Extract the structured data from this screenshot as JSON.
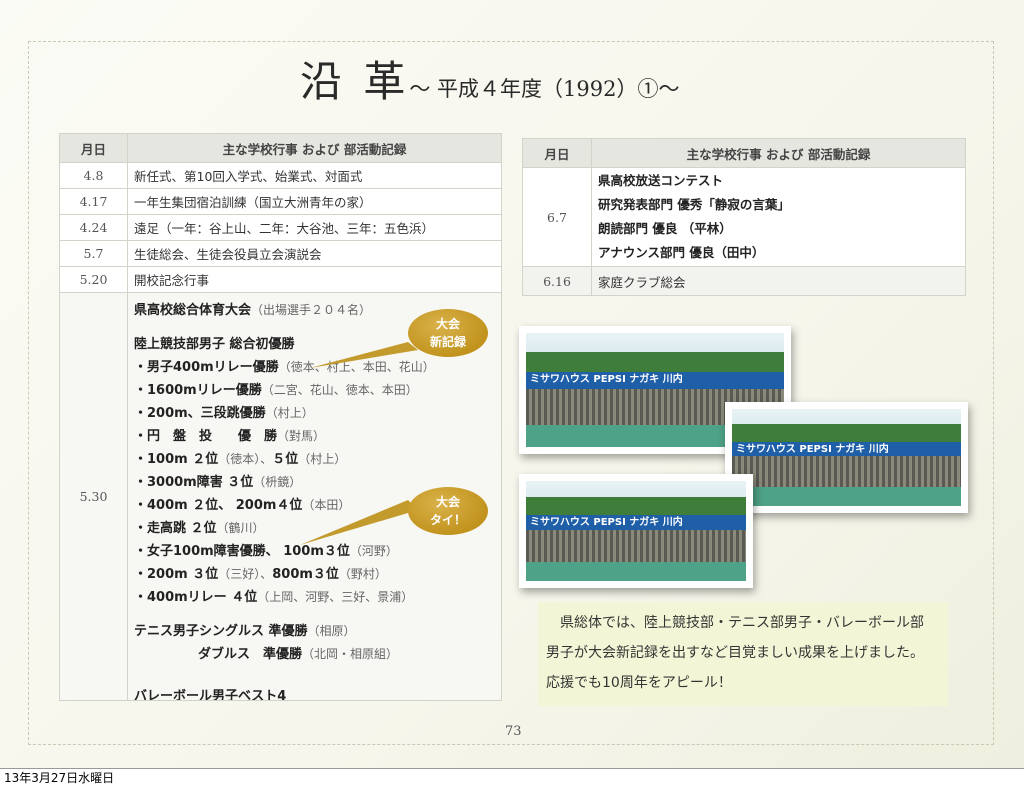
{
  "title": {
    "main": "沿 革",
    "sub": "〜 平成４年度（1992）①〜"
  },
  "left_table": {
    "headers": [
      "月日",
      "主な学校行事 および 部活動記録"
    ],
    "rows": [
      {
        "date": "4.8",
        "text": "新任式、第10回入学式、始業式、対面式"
      },
      {
        "date": "4.17",
        "text": "一年生集団宿泊訓練（国立大洲青年の家）"
      },
      {
        "date": "4.24",
        "text": "遠足（一年：谷上山、二年：大谷池、三年：五色浜）"
      },
      {
        "date": "5.7",
        "text": "生徒総会、生徒会役員立会演説会"
      },
      {
        "date": "5.20",
        "text": "開校記念行事"
      }
    ],
    "big_date": "5.30",
    "lines": [
      {
        "bold": "県高校総合体育大会",
        "note": "（出場選手２０４名）"
      },
      {
        "bold": "陸上競技部男子 総合初優勝",
        "note": ""
      },
      {
        "bold": "・男子400mリレー優勝",
        "note": "（徳本、村上、本田、花山）"
      },
      {
        "bold": "・1600mリレー優勝",
        "note": "（二宮、花山、徳本、本田）"
      },
      {
        "bold": "・200m、三段跳優勝",
        "note": "（村上）"
      },
      {
        "bold": "・円　盤　投　　優　勝",
        "note": "（對馬）"
      },
      {
        "bold": "・100m ２位",
        "note": "（徳本）、",
        "bold2": "５位",
        "note2": "（村上）"
      },
      {
        "bold": "・3000m障害 ３位",
        "note": "（枡鏡）"
      },
      {
        "bold": "・400m ２位、 200m４位",
        "note": "（本田）"
      },
      {
        "bold": "・走高跳 ２位",
        "note": "（鶴川）"
      },
      {
        "bold": "・女子100m障害優勝、 100m３位",
        "note": "（河野）"
      },
      {
        "bold": "・200m ３位",
        "note": "（三好）、",
        "bold2": "800m３位",
        "note2": "（野村）"
      },
      {
        "bold": "・400mリレー ４位",
        "note": "（上岡、河野、三好、景浦）"
      },
      {
        "bold": "テニス男子シングルス 準優勝",
        "note": "（相原）"
      },
      {
        "bold": "ダブルス　準優勝",
        "note": "（北岡・相原組）"
      },
      {
        "bold": "バレーボール男子ベスト4",
        "note": ""
      }
    ]
  },
  "bubbles": {
    "one": [
      "大会",
      "新記録"
    ],
    "two": [
      "大会",
      "タイ！"
    ]
  },
  "right_table": {
    "headers": [
      "月日",
      "主な学校行事 および 部活動記録"
    ],
    "rows": [
      {
        "date": "6.7",
        "lines": [
          "県高校放送コンテスト",
          "研究発表部門 優秀「静寂の言葉」",
          "朗読部門 優良 （平林）",
          "アナウンス部門 優良（田中）"
        ]
      },
      {
        "date": "6.16",
        "lines": [
          "家庭クラブ総会"
        ]
      }
    ]
  },
  "photo_banner": "ミサワハウス PEPSI ナガキ 川内",
  "caption": [
    "県総体では、陸上競技部・テニス部男子・バレーボール部",
    "男子が大会新記録を出すなど目覚ましい成果を上げました。",
    "応援でも10周年をアピール！"
  ],
  "page_number": "73",
  "footer": "13年3月27日水曜日"
}
